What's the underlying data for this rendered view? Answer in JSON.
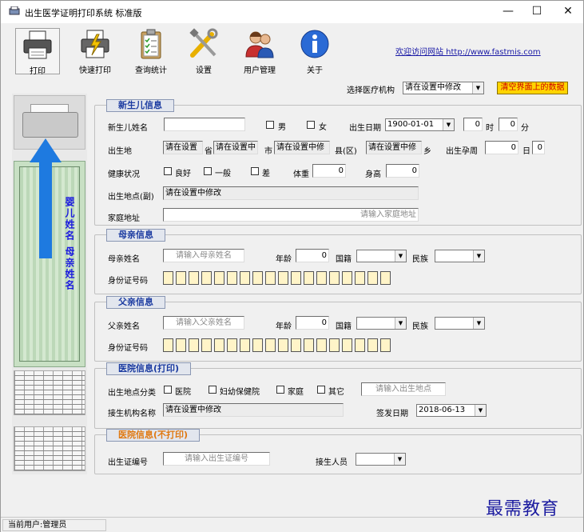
{
  "window": {
    "title": "出生医学证明打印系统 标准版",
    "controls": {
      "minimize": "—",
      "maximize": "☐",
      "close": "✕"
    }
  },
  "toolbar": {
    "print": "打印",
    "quick_print": "快速打印",
    "query_stats": "查询统计",
    "settings": "设置",
    "user_mgmt": "用户管理",
    "about": "关于",
    "site_link": "欢迎访问网站 http://www.fastmis.com"
  },
  "org_select": {
    "label": "选择医疗机构",
    "value": "请在设置中修改"
  },
  "clear_button": "清空界面上的数据",
  "preview": {
    "cert_text": "婴儿姓名 母亲姓名"
  },
  "newborn": {
    "section": "新生儿信息",
    "name_label": "新生儿姓名",
    "name_value": "",
    "male": "男",
    "female": "女",
    "birth_date_label": "出生日期",
    "birth_date": "1900-01-01",
    "hour_value": "0",
    "hour_unit": "时",
    "minute_value": "0",
    "minute_unit": "分",
    "birthplace_label": "出生地",
    "province_value": "请在设置",
    "province_unit": "省",
    "city_value": "请在设置中",
    "city_unit": "市",
    "county_value": "请在设置中修",
    "county_unit": "县(区)",
    "town_value": "请在设置中修",
    "town_unit": "乡",
    "gestation_label": "出生孕周",
    "gestation_value": "0",
    "day_unit": "日",
    "day_value": "0",
    "health_label": "健康状况",
    "health_good": "良好",
    "health_fair": "一般",
    "health_poor": "差",
    "weight_label": "体重",
    "weight_value": "0",
    "height_label": "身高",
    "height_value": "0",
    "birthplace_alt_label": "出生地点(副)",
    "birthplace_alt_value": "请在设置中修改",
    "home_label": "家庭地址",
    "home_placeholder": "请输入家庭地址"
  },
  "mother": {
    "section": "母亲信息",
    "name_label": "母亲姓名",
    "name_placeholder": "请输入母亲姓名",
    "age_label": "年龄",
    "age_value": "0",
    "nationality_label": "国籍",
    "ethnicity_label": "民族",
    "id_label": "身份证号码"
  },
  "father": {
    "section": "父亲信息",
    "name_label": "父亲姓名",
    "name_placeholder": "请输入父亲姓名",
    "age_label": "年龄",
    "age_value": "0",
    "nationality_label": "国籍",
    "ethnicity_label": "民族",
    "id_label": "身份证号码"
  },
  "hospital_print": {
    "section": "医院信息(打印)",
    "place_type_label": "出生地点分类",
    "opt_hospital": "医院",
    "opt_maternal": "妇幼保健院",
    "opt_home": "家庭",
    "opt_other": "其它",
    "place_placeholder": "请输入出生地点",
    "org_label": "接生机构名称",
    "org_value": "请在设置中修改",
    "issue_date_label": "签发日期",
    "issue_date": "2018-06-13"
  },
  "hospital_noprint": {
    "section": "医院信息(不打印)",
    "cert_no_label": "出生证编号",
    "cert_no_placeholder": "请输入出生证编号",
    "midwife_label": "接生人员"
  },
  "status": {
    "current_user": "当前用户:管理员"
  },
  "watermark": "最需教育"
}
